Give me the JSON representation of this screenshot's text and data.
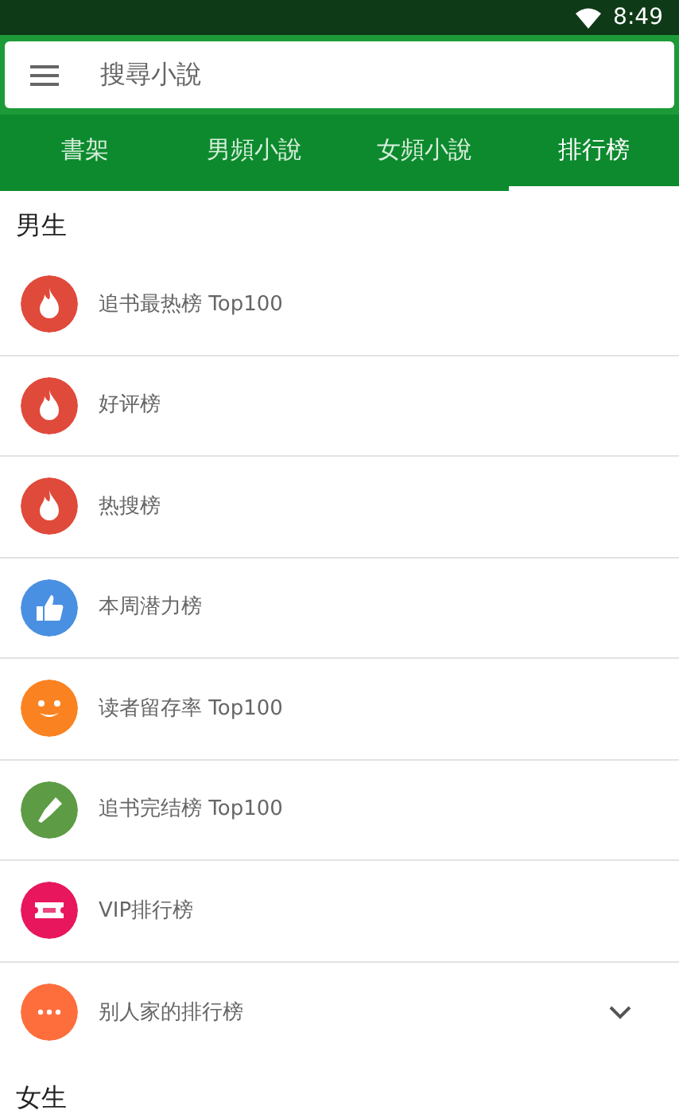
{
  "status_bar": {
    "time": "8:49"
  },
  "search": {
    "placeholder": "搜尋小說"
  },
  "tabs": [
    {
      "label": "書架",
      "selected": false
    },
    {
      "label": "男頻小說",
      "selected": false
    },
    {
      "label": "女頻小說",
      "selected": false
    },
    {
      "label": "排行榜",
      "selected": true
    }
  ],
  "sections": [
    {
      "title": "男生",
      "items": [
        {
          "label": "追书最热榜 Top100",
          "kind": "fire",
          "color": "#e04a3b"
        },
        {
          "label": "好评榜",
          "kind": "fire",
          "color": "#e04a3b"
        },
        {
          "label": "热搜榜",
          "kind": "fire",
          "color": "#e04a3b"
        },
        {
          "label": "本周潜力榜",
          "kind": "thumb",
          "color": "#4a90e2"
        },
        {
          "label": "读者留存率 Top100",
          "kind": "smile",
          "color": "#fb8221"
        },
        {
          "label": "追书完结榜 Top100",
          "kind": "pen",
          "color": "#5d9c45"
        },
        {
          "label": "VIP排行榜",
          "kind": "ticket",
          "color": "#e8175d"
        }
      ],
      "more": {
        "label": "别人家的排行榜",
        "kind": "dots",
        "color": "#fe6e3d",
        "expanded": false
      }
    },
    {
      "title": "女生"
    }
  ]
}
